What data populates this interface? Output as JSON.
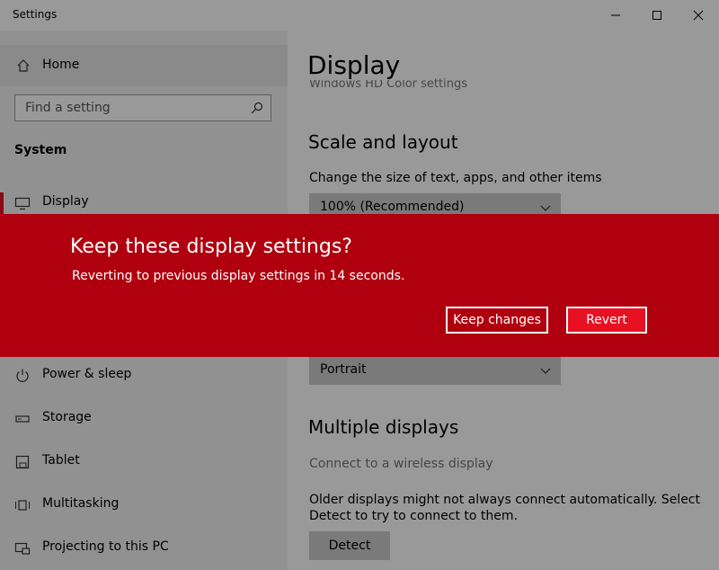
{
  "window": {
    "title": "Settings"
  },
  "sidebar": {
    "home_label": "Home",
    "search_placeholder": "Find a setting",
    "section_title": "System",
    "items": [
      {
        "label": "Display",
        "icon": "monitor-icon",
        "active": true
      },
      {
        "label": "Power & sleep",
        "icon": "power-icon"
      },
      {
        "label": "Storage",
        "icon": "storage-icon"
      },
      {
        "label": "Tablet",
        "icon": "tablet-icon"
      },
      {
        "label": "Multitasking",
        "icon": "multitasking-icon"
      },
      {
        "label": "Projecting to this PC",
        "icon": "projecting-icon"
      }
    ]
  },
  "content": {
    "page_title": "Display",
    "hidden_link": "Windows HD Color settings",
    "scale_heading": "Scale and layout",
    "scale_label": "Change the size of text, apps, and other items",
    "scale_value": "100% (Recommended)",
    "orientation_value": "Portrait",
    "multi_heading": "Multiple displays",
    "wireless_link": "Connect to a wireless display",
    "detect_text": "Older displays might not always connect automatically. Select Detect to try to connect to them.",
    "detect_button": "Detect"
  },
  "banner": {
    "heading": "Keep these display settings?",
    "message": "Reverting to previous display settings in 14 seconds.",
    "keep_label": "Keep changes",
    "revert_label": "Revert"
  },
  "colors": {
    "banner_bg": "#b0000f",
    "revert_bg": "#e81123",
    "accent": "#e81123"
  }
}
